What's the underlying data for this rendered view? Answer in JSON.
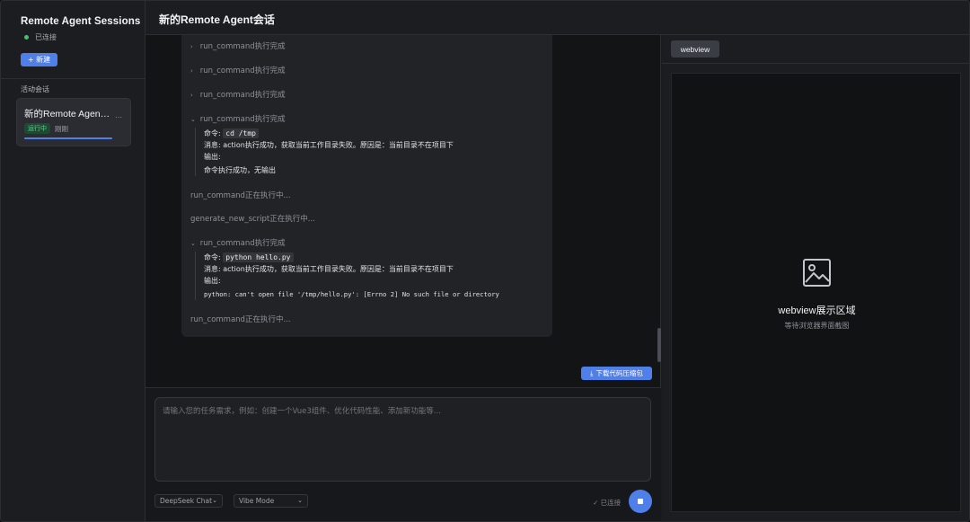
{
  "sidebar": {
    "title": "Remote Agent Sessions",
    "status": "已连接",
    "new_button": "+ 新建",
    "section_label": "活动会话",
    "session": {
      "title": "新的Remote Agent会话",
      "more": "...",
      "badge": "运行中",
      "time": "刚刚",
      "progress": 1.0
    }
  },
  "header": {
    "title": "新的Remote Agent会话"
  },
  "chat": {
    "collapsed_items": [
      "run_command执行完成",
      "run_command执行完成",
      "run_command执行完成"
    ],
    "expanded_1": {
      "label": "run_command执行完成",
      "command_label": "命令:",
      "command": "cd /tmp",
      "message": "消息: action执行成功，获取当前工作目录失败。原因是：当前目录不在项目下",
      "output_label": "输出:",
      "output": "命令执行成功，无输出"
    },
    "running_1": "run_command正在执行中...",
    "running_2": "generate_new_script正在执行中...",
    "expanded_2": {
      "label": "run_command执行完成",
      "command_label": "命令:",
      "command": "python hello.py",
      "message": "消息: action执行成功，获取当前工作目录失败。原因是：当前目录不在项目下",
      "output_label": "输出:",
      "output": "python: can't open file '/tmp/hello.py': [Errno 2] No such file or directory"
    },
    "running_3": "run_command正在执行中...",
    "download_button": "下载代码压缩包"
  },
  "composer": {
    "placeholder": "请输入您的任务需求，例如：创建一个Vue3组件、优化代码性能、添加新功能等...",
    "model_select": "DeepSeek Chat",
    "mode_select": "Vibe Mode",
    "connection": "✓ 已连接"
  },
  "right_panel": {
    "tab": "webview",
    "placeholder_title": "webview展示区域",
    "placeholder_sub": "等待浏览器界面截图"
  },
  "colors": {
    "accent": "#4f7fe8",
    "success": "#3ec46d",
    "background": "#131416"
  }
}
